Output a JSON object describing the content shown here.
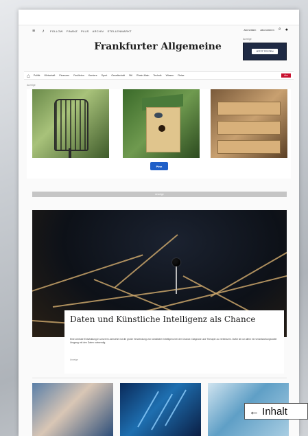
{
  "nav": {
    "sections": [
      "FOLLOW",
      "FINANZ",
      "PLUS",
      "ARCHIV",
      "STELLENMARKT"
    ],
    "right_links": [
      "Anmelden",
      "Abonnieren"
    ]
  },
  "logo": {
    "text": "Frankfurter Allgemeine"
  },
  "ad_box": {
    "label": "Anzeige",
    "button": "JETZT TESTEN"
  },
  "ressort": {
    "items": [
      "Politik",
      "Wirtschaft",
      "Finanzen",
      "Feuilleton",
      "Karriere",
      "Sport",
      "Gesellschaft",
      "Stil",
      "Rhein-Main",
      "Technik",
      "Wissen",
      "Reise"
    ],
    "abo": "Abo"
  },
  "anzeige_label": "Anzeige",
  "ad_badge": "Pinn",
  "grey_bar_label": "Anzeige",
  "hero": {
    "headline": "Daten und Künstliche Intelligenz als Chance",
    "teaser": "Eine zentrale Entwicklung in unserem Jahrzehnt ist die große Verwendung von künstlicher Intelligenz bei der Chance. Diagnose und Therapie zu verbessern. Dafür ist vor allem ein verantwortungsvoller Umgang mit den Daten notwendig.",
    "byline": "Anzeige"
  },
  "inhalt_button": "← Inhalt",
  "colors": {
    "abo": "#c8102e",
    "ad_box": "#1f2a44",
    "ad_badge": "#1f5fc8"
  }
}
